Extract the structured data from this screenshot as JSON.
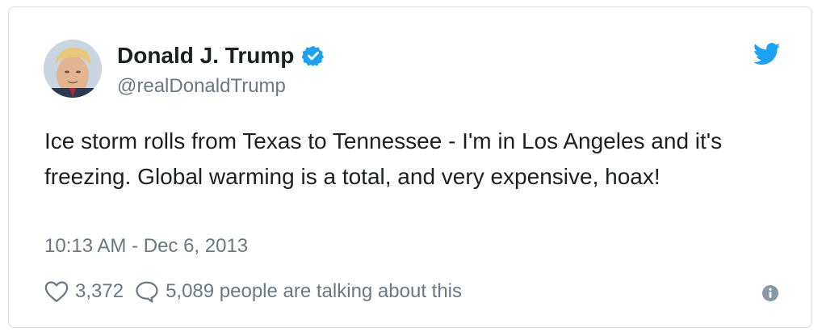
{
  "tweet": {
    "display_name": "Donald J. Trump",
    "handle": "@realDonaldTrump",
    "text": "Ice storm rolls from Texas to Tennessee - I'm in Los Angeles and it's freezing. Global warming is a total, and very expensive, hoax!",
    "timestamp": "10:13 AM - Dec 6, 2013",
    "likes": "3,372",
    "talking": "5,089 people are talking about this"
  },
  "colors": {
    "verified": "#1da1f2",
    "twitter_brand": "#1da1f2",
    "secondary_text": "#697882",
    "primary_text": "#1c2022"
  },
  "icons": [
    "avatar",
    "verified-badge-icon",
    "twitter-bird-icon",
    "heart-icon",
    "reply-icon",
    "info-icon"
  ]
}
